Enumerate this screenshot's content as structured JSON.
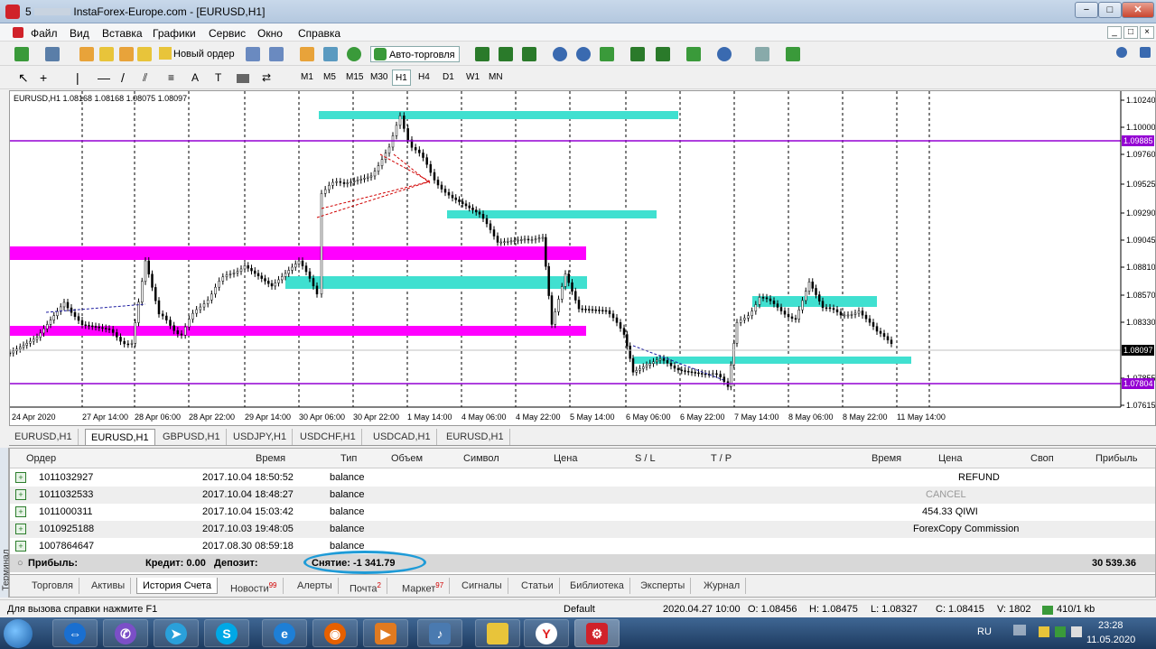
{
  "window": {
    "title_prefix": "5",
    "title": "InstaForex-Europe.com - [EURUSD,H1]",
    "btn_min": "−",
    "btn_max": "□",
    "btn_close": "✕"
  },
  "menu": [
    "Файл",
    "Вид",
    "Вставка",
    "Графики",
    "Сервис",
    "Окно",
    "Справка"
  ],
  "mdi": [
    "_",
    "□",
    "×"
  ],
  "toolbar1": {
    "new_order": "Новый ордер",
    "auto_trading": "Авто-торговля"
  },
  "toolbar2": {
    "timeframes": [
      "M1",
      "M5",
      "M15",
      "M30",
      "H1",
      "H4",
      "D1",
      "W1",
      "MN"
    ],
    "active_timeframe": "H1",
    "text_tool": "A"
  },
  "chart": {
    "header": "EURUSD,H1  1.08168 1.08168 1.08075 1.08097",
    "price_ticks": [
      "1.10240",
      "1.10000",
      "1.09760",
      "1.09525",
      "1.09290",
      "1.09045",
      "1.08810",
      "1.08570",
      "1.08330",
      "1.07855",
      "1.07615"
    ],
    "price_labels": {
      "purple_top": "1.09885",
      "current": "1.08097",
      "purple_bottom": "1.07804"
    },
    "time_ticks": [
      "24 Apr 2020",
      "27 Apr 14:00",
      "28 Apr 06:00",
      "28 Apr 22:00",
      "29 Apr 14:00",
      "30 Apr 06:00",
      "30 Apr 22:00",
      "1 May 14:00",
      "4 May 06:00",
      "4 May 22:00",
      "5 May 14:00",
      "6 May 06:00",
      "6 May 22:00",
      "7 May 14:00",
      "8 May 06:00",
      "8 May 22:00",
      "11 May 14:00"
    ],
    "colors": {
      "cyan": "#40e0d0",
      "magenta": "#ff00ff",
      "purple": "#9400d3",
      "candle": "#000000"
    }
  },
  "chart_tabs": [
    "EURUSD,H1",
    "EURUSD,H1",
    "GBPUSD,H1",
    "USDJPY,H1",
    "USDCHF,H1",
    "USDCAD,H1",
    "EURUSD,H1"
  ],
  "chart_tab_active": 1,
  "terminal": {
    "side_label": "Терминал",
    "headers": {
      "order": "Ордер",
      "time": "Время",
      "type": "Тип",
      "volume": "Объем",
      "symbol": "Символ",
      "price": "Цена",
      "sl": "S / L",
      "tp": "T / P",
      "time2": "Время",
      "price2": "Цена",
      "swap": "Своп",
      "profit": "Прибыль"
    },
    "rows": [
      {
        "order": "1011032927",
        "time": "2017.10.04 18:50:52",
        "type": "balance",
        "comment": "REFUND"
      },
      {
        "order": "1011032533",
        "time": "2017.10.04 18:48:27",
        "type": "balance",
        "comment": "CANCEL"
      },
      {
        "order": "1011000311",
        "time": "2017.10.04 15:03:42",
        "type": "balance",
        "comment": "454.33 QIWI"
      },
      {
        "order": "1010925188",
        "time": "2017.10.03 19:48:05",
        "type": "balance",
        "comment": "ForexCopy Commission"
      },
      {
        "order": "1007864647",
        "time": "2017.08.30 08:59:18",
        "type": "balance",
        "comment": ""
      }
    ],
    "summary": {
      "profit_label": "Прибыль:",
      "credit": "Кредит: 0.00",
      "deposit_label": "Депозит:",
      "withdrawal": "Снятие: -1 341.79",
      "total": "30 539.36"
    },
    "tabs": [
      {
        "label": "Торговля",
        "badge": ""
      },
      {
        "label": "Активы",
        "badge": ""
      },
      {
        "label": "История Счета",
        "badge": ""
      },
      {
        "label": "Новости",
        "badge": "99"
      },
      {
        "label": "Алерты",
        "badge": ""
      },
      {
        "label": "Почта",
        "badge": "2"
      },
      {
        "label": "Маркет",
        "badge": "97"
      },
      {
        "label": "Сигналы",
        "badge": ""
      },
      {
        "label": "Статьи",
        "badge": ""
      },
      {
        "label": "Библиотека",
        "badge": ""
      },
      {
        "label": "Эксперты",
        "badge": ""
      },
      {
        "label": "Журнал",
        "badge": ""
      }
    ],
    "active_tab": 2
  },
  "status": {
    "help": "Для вызова справки нажмите F1",
    "profile": "Default",
    "datetime": "2020.04.27 10:00",
    "open": "O: 1.08456",
    "high": "H: 1.08475",
    "low": "L: 1.08327",
    "close": "C: 1.08415",
    "volume": "V: 1802",
    "traffic": "410/1 kb"
  },
  "taskbar": {
    "lang": "RU",
    "time": "23:28",
    "date": "11.05.2020",
    "apps": [
      "teamviewer",
      "viber",
      "telegram",
      "skype",
      "ie",
      "firefox",
      "player",
      "audio",
      "explorer",
      "yandex",
      "instaforex"
    ]
  }
}
